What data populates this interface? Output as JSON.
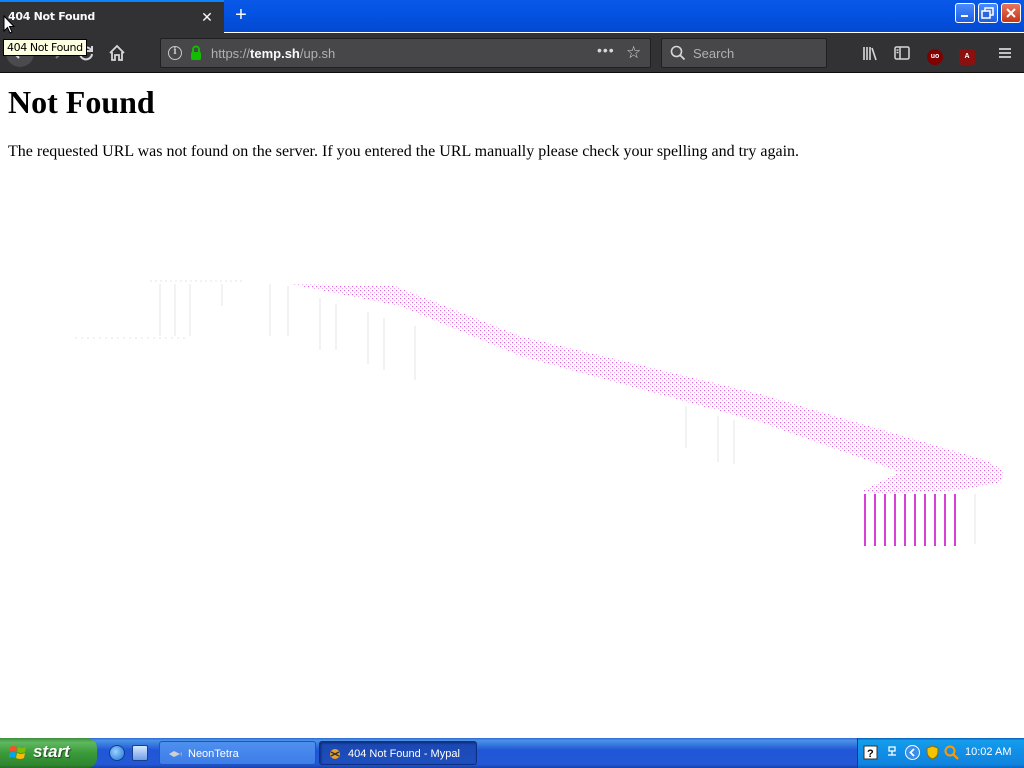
{
  "browser": {
    "tab_title": "404 Not Found",
    "tab_close_glyph": "✕",
    "new_tab_glyph": "+",
    "tooltip": "404 Not Found",
    "url": {
      "scheme": "https://",
      "host": "temp.sh",
      "path": "/up.sh"
    },
    "url_more_glyph": "•••",
    "search_placeholder": "Search",
    "icons": [
      "back-icon",
      "forward-icon",
      "reload-icon",
      "home-icon",
      "info-icon",
      "lock-icon",
      "page-actions-icon",
      "bookmark-star-icon",
      "search-icon",
      "library-icon",
      "sidebar-icon",
      "ublock-icon",
      "extension-icon",
      "menu-icon"
    ],
    "ublock_badge": "uo",
    "extension_badge": "A",
    "accent": "#0a84ff",
    "lock_color": "#12bc00"
  },
  "page": {
    "heading": "Not Found",
    "message": "The requested URL was not found on the server. If you entered the URL manually please check your spelling and try again.",
    "artifact_color": "#c800c8"
  },
  "taskbar": {
    "start_label": "start",
    "tasks": [
      {
        "label": "NeonTetra",
        "active": false
      },
      {
        "label": "404 Not Found - Mypal",
        "active": true
      }
    ],
    "clock": "10:02 AM"
  }
}
